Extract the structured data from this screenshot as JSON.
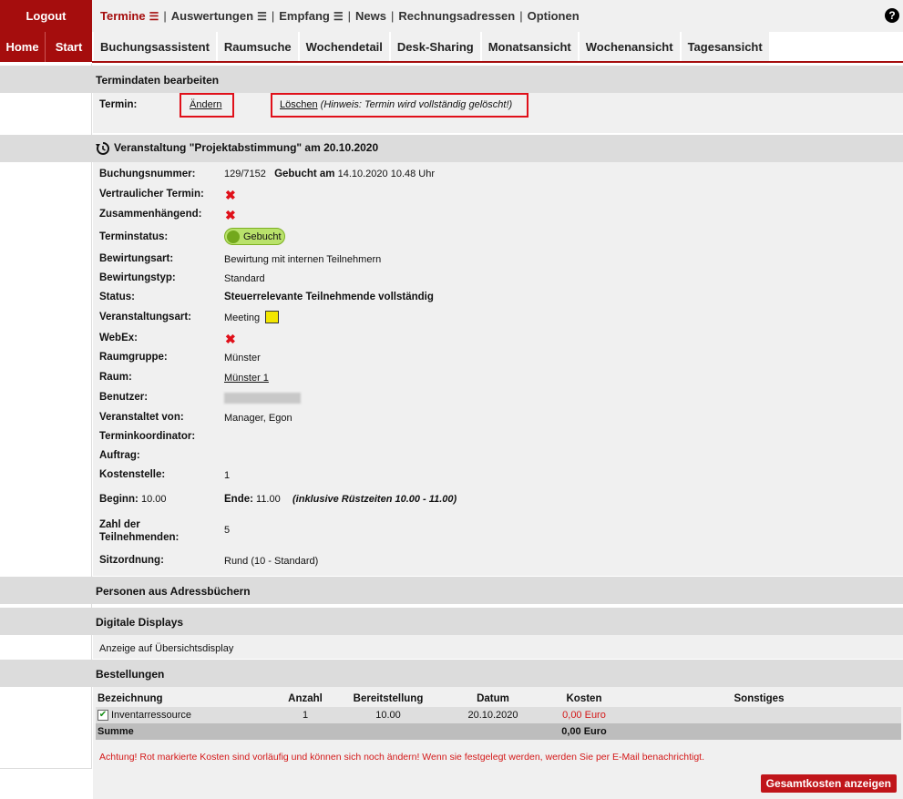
{
  "topbar": {
    "logout": "Logout",
    "nav": [
      {
        "label": "Termine",
        "menu": true,
        "active": true
      },
      {
        "label": "Auswertungen",
        "menu": true
      },
      {
        "label": "Empfang",
        "menu": true
      },
      {
        "label": "News"
      },
      {
        "label": "Rechnungsadressen"
      },
      {
        "label": "Optionen"
      }
    ],
    "help": "?"
  },
  "leftbuttons": {
    "home": "Home",
    "start": "Start"
  },
  "tabs": [
    "Buchungsassistent",
    "Raumsuche",
    "Wochendetail",
    "Desk-Sharing",
    "Monatsansicht",
    "Wochenansicht",
    "Tagesansicht"
  ],
  "sections": {
    "edit_title": "Termindaten bearbeiten",
    "termin_label": "Termin:",
    "change_link": "Ändern",
    "delete_link": "Löschen",
    "delete_hint": "(Hinweis: Termin wird vollständig gelöscht!)",
    "event_title": "Veranstaltung \"Projektabstimmung\" am 20.10.2020",
    "persons_title": "Personen aus Adressbüchern",
    "displays_title": "Digitale Displays",
    "displays_text": "Anzeige auf Übersichtsdisplay",
    "orders_title": "Bestellungen"
  },
  "details": {
    "booking_no_label": "Buchungsnummer:",
    "booking_no": "129/7152",
    "booked_on_label": "Gebucht am",
    "booked_on": "14.10.2020 10.48 Uhr",
    "confidential_label": "Vertraulicher Termin:",
    "connected_label": "Zusammenhängend:",
    "status_label_t": "Terminstatus:",
    "status_toggle": "Gebucht",
    "catering_type_label": "Bewirtungsart:",
    "catering_type": "Bewirtung mit internen Teilnehmern",
    "catering_kind_label": "Bewirtungstyp:",
    "catering_kind": "Standard",
    "status_label": "Status:",
    "status_value": "Steuerrelevante Teilnehmende vollständig",
    "event_type_label": "Veranstaltungsart:",
    "event_type": "Meeting",
    "event_type_color": "#f2e600",
    "webex_label": "WebEx:",
    "roomgroup_label": "Raumgruppe:",
    "roomgroup": "Münster",
    "room_label": "Raum:",
    "room": "Münster 1",
    "user_label": "Benutzer:",
    "organizer_label": "Veranstaltet von:",
    "organizer": "Manager, Egon",
    "coordinator_label": "Terminkoordinator:",
    "order_label": "Auftrag:",
    "costcenter_label": "Kostenstelle:",
    "costcenter": "1",
    "begin_label": "Beginn:",
    "begin": "10.00",
    "end_label": "Ende:",
    "end": "11.00",
    "setup_note": "(inklusive Rüstzeiten 10.00 - 11.00)",
    "participants_label": "Zahl der Teilnehmenden:",
    "participants": "5",
    "seating_label": "Sitzordnung:",
    "seating": "Rund (10 - Standard)"
  },
  "orders": {
    "headers": [
      "Bezeichnung",
      "Anzahl",
      "Bereitstellung",
      "Datum",
      "Kosten",
      "Sonstiges"
    ],
    "rows": [
      {
        "name": "Inventarressource",
        "count": "1",
        "time": "10.00",
        "date": "20.10.2020",
        "cost": "0,00 Euro",
        "other": ""
      }
    ],
    "sum_label": "Summe",
    "sum_value": "0,00 Euro",
    "warning": "Achtung! Rot markierte Kosten sind vorläufig und können sich noch ändern! Wenn sie festgelegt werden, werden Sie per E-Mail benachrichtigt.",
    "total_button": "Gesamtkosten anzeigen"
  },
  "colors": {
    "brand": "#a50d0d",
    "alert": "#e0101a"
  }
}
